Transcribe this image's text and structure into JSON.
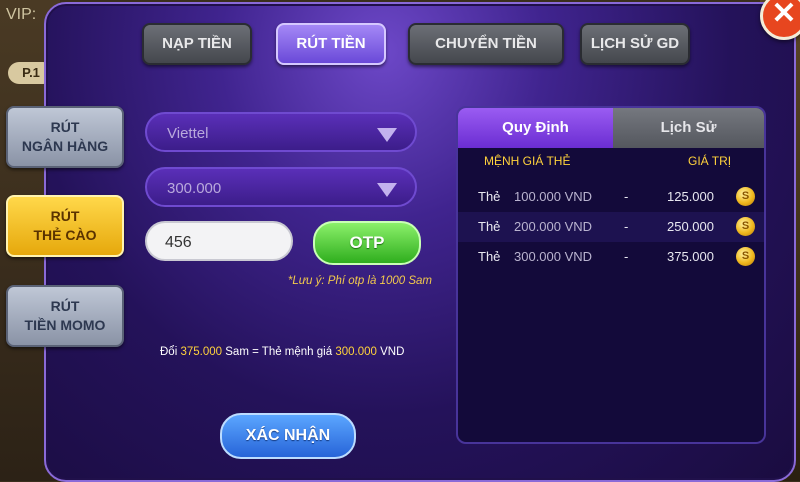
{
  "background": {
    "vip_label": "VIP:",
    "badge_label": "P.1"
  },
  "close_icon": "close-icon",
  "top_tabs": [
    {
      "label": "NẠP TIỀN",
      "active": false
    },
    {
      "label": "RÚT TIỀN",
      "active": true
    },
    {
      "label": "CHUYỂN TIỀN",
      "active": false
    },
    {
      "label": "LỊCH SỬ GD",
      "active": false
    }
  ],
  "side_tabs": [
    {
      "line1": "RÚT",
      "line2": "NGÂN HÀNG",
      "active": false
    },
    {
      "line1": "RÚT",
      "line2": "THẺ CÀO",
      "active": true
    },
    {
      "line1": "RÚT",
      "line2": "TIỀN MOMO",
      "active": false
    }
  ],
  "form": {
    "carrier_select": "Viettel",
    "amount_select": "300.000",
    "otp_value": "456",
    "otp_button": "OTP",
    "note": "*Lưu ý: Phí otp là 1000 Sam",
    "convert": {
      "prefix": "Đổi",
      "sam_amount": "375.000",
      "middle": "Sam = Thẻ mệnh giá",
      "card_amount": "300.000",
      "suffix": "VND"
    },
    "confirm_button": "XÁC NHẬN"
  },
  "rules_panel": {
    "tabs": [
      "Quy Định",
      "Lịch Sử"
    ],
    "headers": [
      "MỆNH GIÁ THẺ",
      "GIÁ TRỊ"
    ],
    "rows": [
      {
        "label": "Thẻ",
        "face": "100.000 VND",
        "sep": "-",
        "price": "125.000"
      },
      {
        "label": "Thẻ",
        "face": "200.000 VND",
        "sep": "-",
        "price": "250.000"
      },
      {
        "label": "Thẻ",
        "face": "300.000 VND",
        "sep": "-",
        "price": "375.000"
      }
    ],
    "coin_icon": "coin-icon",
    "coin_glyph": "S"
  },
  "colors": {
    "accent_purple": "#6a49d8",
    "active_side_tab": "#e6a80c",
    "highlight_yellow": "#ffd23c",
    "otp_green": "#2fae1e",
    "confirm_blue": "#2764d8",
    "close_red": "#e7461f"
  }
}
